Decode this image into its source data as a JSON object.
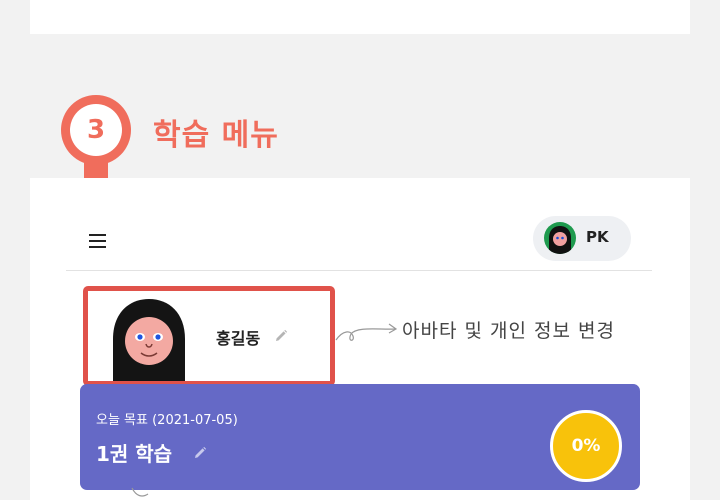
{
  "section": {
    "number": "3",
    "title": "학습 메뉴"
  },
  "header": {
    "menu_icon": "hamburger-icon",
    "user_initials": "PK"
  },
  "profile": {
    "name": "홍길동",
    "edit_icon": "pencil-icon",
    "annotation": "아바타 및 개인 정보 변경"
  },
  "goal": {
    "label": "오늘 목표 (2021-07-05)",
    "value": "1권 학습",
    "progress_text": "0%",
    "progress": 0
  },
  "colors": {
    "accent": "#f06d5c",
    "highlight_border": "#e0524a",
    "goal_card": "#6569c6",
    "progress": "#f8c20b",
    "avatar_bg": "#1e9a4e"
  }
}
